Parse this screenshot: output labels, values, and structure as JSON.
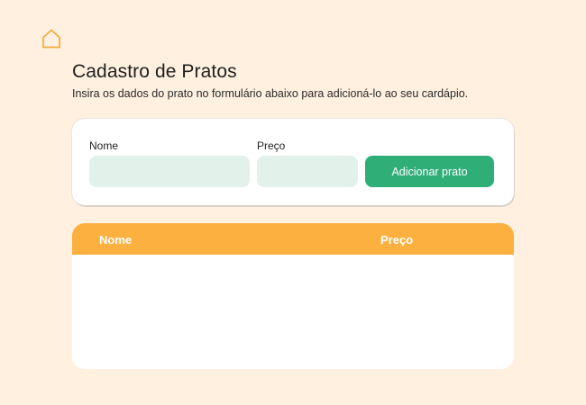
{
  "header": {
    "home_icon": "home-icon"
  },
  "main": {
    "title": "Cadastro de Pratos",
    "subtitle": "Insira os dados do prato no formulário abaixo para adicioná-lo ao seu cardápio."
  },
  "form": {
    "name_label": "Nome",
    "name_value": "",
    "price_label": "Preço",
    "price_value": "",
    "submit_label": "Adicionar prato"
  },
  "table": {
    "columns": [
      "Nome",
      "Preço"
    ],
    "rows": []
  },
  "colors": {
    "background": "#FFF0E0",
    "accent_orange": "#FBB040",
    "button_green": "#2FAE78",
    "input_fill": "#E2F2EB"
  }
}
